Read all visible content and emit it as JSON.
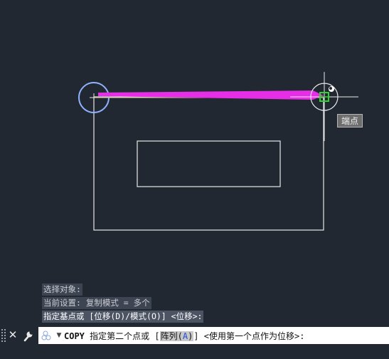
{
  "tooltip": {
    "snap_label": "端点"
  },
  "history": [
    "选择对象:",
    "当前设置:  复制模式 = 多个",
    "指定基点或 [位移(D)/模式(O)] <位移>:"
  ],
  "command_line": {
    "command": "COPY",
    "prompt": "指定第二个点或 [",
    "option_label": "阵列(",
    "option_key": "A",
    "option_close": ")",
    "suffix": "] <使用第一个点作为位移>:"
  },
  "colors": {
    "background": "#222831",
    "rubber_band": "#e62ee6",
    "snap_marker": "#2fd42f",
    "geometry": "#e8e8e8"
  }
}
